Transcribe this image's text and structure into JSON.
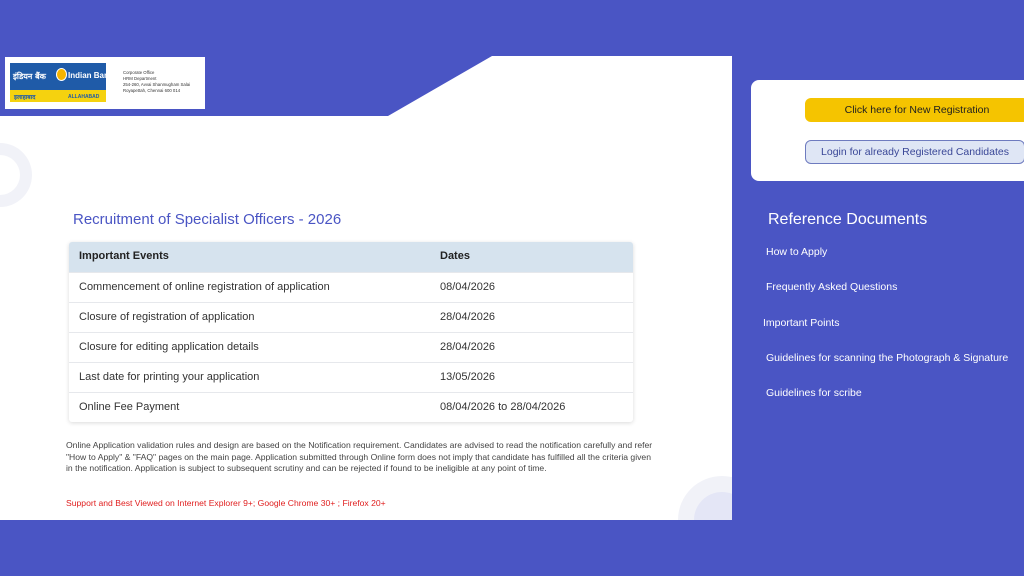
{
  "header": {
    "logo_hindi": "इंडियन बैंक",
    "logo_english": "Indian Bank",
    "logo_sub_hindi": "इलाहाबाद",
    "logo_sub_english": "ALLAHABAD",
    "address": [
      "Corporate Office",
      "HRM Department",
      "254-260, Avvai Shanmugham Salai",
      "Royapettah, Chennai 600 014"
    ]
  },
  "main": {
    "title": "Recruitment of Specialist Officers - 2026",
    "table": {
      "headers": [
        "Important Events",
        "Dates"
      ],
      "rows": [
        [
          "Commencement of online registration of application",
          "08/04/2026"
        ],
        [
          "Closure of registration of application",
          "28/04/2026"
        ],
        [
          "Closure for editing application details",
          "28/04/2026"
        ],
        [
          "Last date for printing your application",
          "13/05/2026"
        ],
        [
          "Online Fee Payment",
          "08/04/2026 to 28/04/2026"
        ]
      ]
    },
    "notice": "Online Application validation rules and design are based on the Notification requirement. Candidates are advised to read the notification carefully and refer \"How to Apply\" & \"FAQ\" pages on the main page. Application submitted through Online form does not imply that candidate has fulfilled all the criteria given in the notification. Application is subject to subsequent scrutiny and can be rejected if found to be ineligible at any point of time.",
    "support": "Support and Best Viewed on Internet Explorer 9+; Google Chrome 30+ ; Firefox 20+"
  },
  "actions": {
    "register_label": "Click here for New Registration",
    "login_label": "Login for already Registered Candidates"
  },
  "reference": {
    "title": "Reference Documents",
    "links": [
      "How to Apply",
      "Frequently Asked Questions",
      "Important Points",
      "Guidelines for scanning the Photograph & Signature",
      "Guidelines for scribe"
    ]
  },
  "colors": {
    "background": "#4a55c4",
    "accent_yellow": "#f5c400",
    "table_header": "#d6e3ee",
    "title_blue": "#4a55c4",
    "support_red": "#e02020"
  }
}
